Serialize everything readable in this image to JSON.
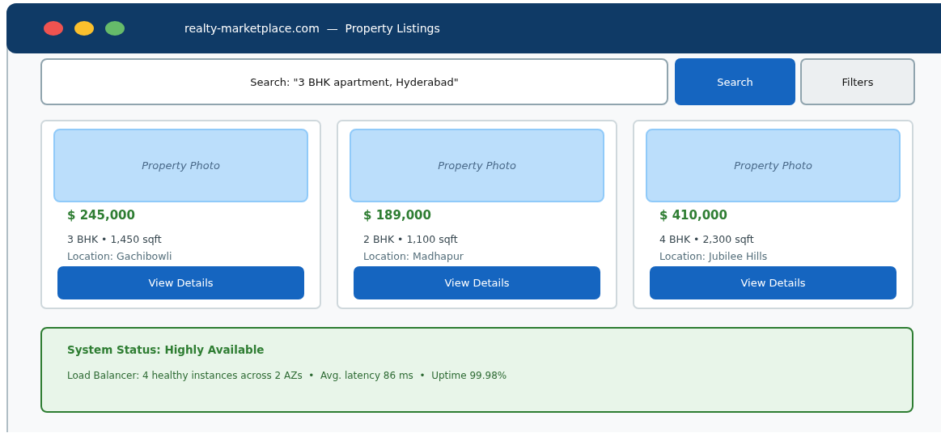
{
  "window": {
    "title": "realty-marketplace.com  —  Property Listings",
    "controls": [
      {
        "color": "#ef5350"
      },
      {
        "color": "#fbc02d"
      },
      {
        "color": "#66bb6a"
      }
    ]
  },
  "search": {
    "value": "Search: \"3 BHK apartment, Hyderabad\"",
    "buttons": [
      {
        "label": "Search",
        "kind": "primary"
      },
      {
        "label": "Filters",
        "kind": "secondary"
      }
    ]
  },
  "listings": [
    {
      "photo": "Property Photo",
      "price": "$ 245,000",
      "specs": "3 BHK • 1,450 sqft",
      "location": "Location: Gachibowli",
      "action": "View Details"
    },
    {
      "photo": "Property Photo",
      "price": "$ 189,000",
      "specs": "2 BHK • 1,100 sqft",
      "location": "Location: Madhapur",
      "action": "View Details"
    },
    {
      "photo": "Property Photo",
      "price": "$ 410,000",
      "specs": "4 BHK • 2,300 sqft",
      "location": "Location: Jubilee Hills",
      "action": "View Details"
    }
  ],
  "status": {
    "title": "System Status: Highly Available",
    "detail": "Load Balancer: 4 healthy instances across 2 AZs  •  Avg. latency 86 ms  •  Uptime 99.98%"
  }
}
